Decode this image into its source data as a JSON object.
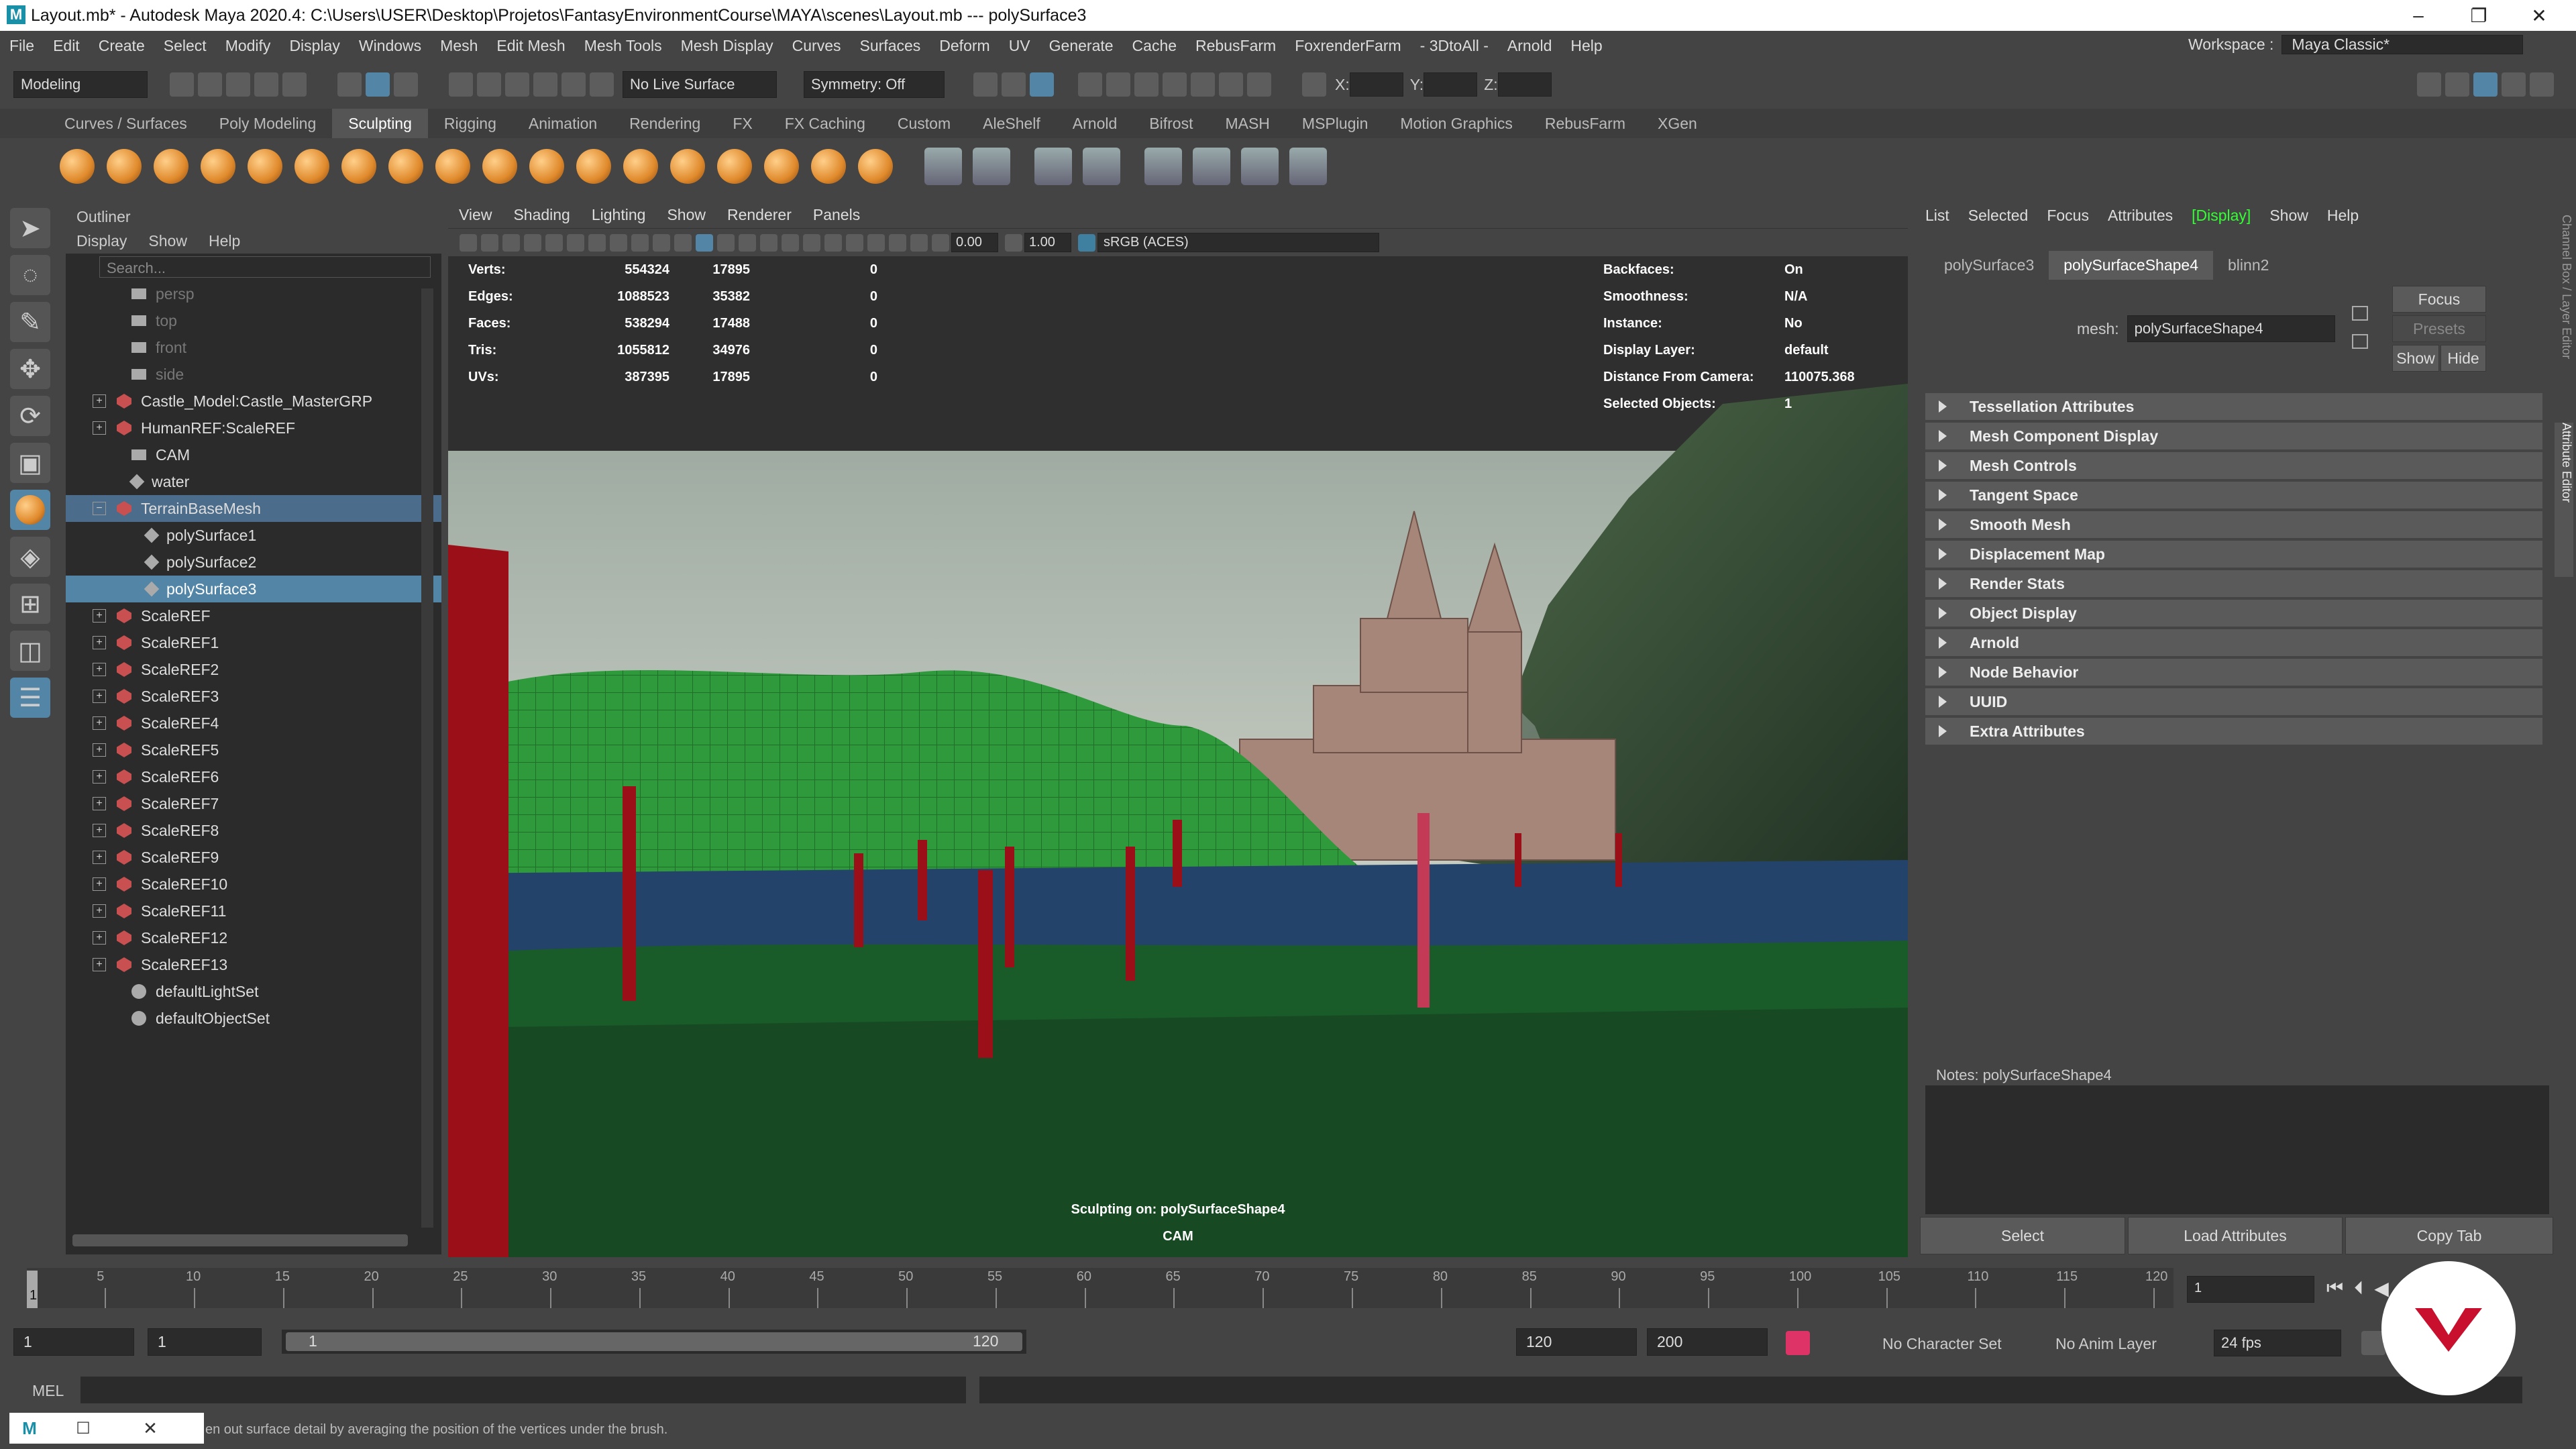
{
  "window": {
    "title": "Layout.mb* - Autodesk Maya 2020.4: C:\\Users\\USER\\Desktop\\Projetos\\FantasyEnvironmentCourse\\MAYA\\scenes\\Layout.mb   ---   polySurface3",
    "min": "–",
    "max": "❐",
    "close": "✕"
  },
  "menubar": [
    "File",
    "Edit",
    "Create",
    "Select",
    "Modify",
    "Display",
    "Windows",
    "Mesh",
    "Edit Mesh",
    "Mesh Tools",
    "Mesh Display",
    "Curves",
    "Surfaces",
    "Deform",
    "UV",
    "Generate",
    "Cache",
    "RebusFarm",
    "FoxrenderFarm",
    "- 3DtoAll -",
    "Arnold",
    "Help"
  ],
  "workspace": {
    "label": "Workspace :",
    "value": "Maya Classic*"
  },
  "statusline": {
    "menuset": "Modeling",
    "live_surface": "No Live Surface",
    "symmetry": "Symmetry: Off",
    "x": "X:",
    "y": "Y:",
    "z": "Z:"
  },
  "shelf_tabs": [
    "Curves / Surfaces",
    "Poly Modeling",
    "Sculpting",
    "Rigging",
    "Animation",
    "Rendering",
    "FX",
    "FX Caching",
    "Custom",
    "AleShelf",
    "Arnold",
    "Bifrost",
    "MASH",
    "MSPlugin",
    "Motion Graphics",
    "RebusFarm",
    "XGen"
  ],
  "shelf_active": "Sculpting",
  "outliner": {
    "title": "Outliner",
    "menu": [
      "Display",
      "Show",
      "Help"
    ],
    "search_placeholder": "Search...",
    "items": [
      {
        "label": "persp",
        "kind": "camera",
        "depth": 1,
        "dim": true
      },
      {
        "label": "top",
        "kind": "camera",
        "depth": 1,
        "dim": true
      },
      {
        "label": "front",
        "kind": "camera",
        "depth": 1,
        "dim": true
      },
      {
        "label": "side",
        "kind": "camera",
        "depth": 1,
        "dim": true
      },
      {
        "label": "Castle_Model:Castle_MasterGRP",
        "kind": "group",
        "depth": 0,
        "expand": "+"
      },
      {
        "label": "HumanREF:ScaleREF",
        "kind": "group",
        "depth": 0,
        "expand": "+"
      },
      {
        "label": "CAM",
        "kind": "camera",
        "depth": 1
      },
      {
        "label": "water",
        "kind": "mesh",
        "depth": 1
      },
      {
        "label": "TerrainBaseMesh",
        "kind": "group",
        "depth": 0,
        "expand": "−",
        "state": "hl"
      },
      {
        "label": "polySurface1",
        "kind": "mesh",
        "depth": 2
      },
      {
        "label": "polySurface2",
        "kind": "mesh",
        "depth": 2
      },
      {
        "label": "polySurface3",
        "kind": "mesh",
        "depth": 2,
        "state": "sel"
      },
      {
        "label": "ScaleREF",
        "kind": "group",
        "depth": 0,
        "expand": "+"
      },
      {
        "label": "ScaleREF1",
        "kind": "group",
        "depth": 0,
        "expand": "+"
      },
      {
        "label": "ScaleREF2",
        "kind": "group",
        "depth": 0,
        "expand": "+"
      },
      {
        "label": "ScaleREF3",
        "kind": "group",
        "depth": 0,
        "expand": "+"
      },
      {
        "label": "ScaleREF4",
        "kind": "group",
        "depth": 0,
        "expand": "+"
      },
      {
        "label": "ScaleREF5",
        "kind": "group",
        "depth": 0,
        "expand": "+"
      },
      {
        "label": "ScaleREF6",
        "kind": "group",
        "depth": 0,
        "expand": "+"
      },
      {
        "label": "ScaleREF7",
        "kind": "group",
        "depth": 0,
        "expand": "+"
      },
      {
        "label": "ScaleREF8",
        "kind": "group",
        "depth": 0,
        "expand": "+"
      },
      {
        "label": "ScaleREF9",
        "kind": "group",
        "depth": 0,
        "expand": "+"
      },
      {
        "label": "ScaleREF10",
        "kind": "group",
        "depth": 0,
        "expand": "+"
      },
      {
        "label": "ScaleREF11",
        "kind": "group",
        "depth": 0,
        "expand": "+"
      },
      {
        "label": "ScaleREF12",
        "kind": "group",
        "depth": 0,
        "expand": "+"
      },
      {
        "label": "ScaleREF13",
        "kind": "group",
        "depth": 0,
        "expand": "+"
      },
      {
        "label": "defaultLightSet",
        "kind": "set",
        "depth": 1
      },
      {
        "label": "defaultObjectSet",
        "kind": "set",
        "depth": 1
      }
    ]
  },
  "viewport": {
    "menu": [
      "View",
      "Shading",
      "Lighting",
      "Show",
      "Renderer",
      "Panels"
    ],
    "exposure": "0.00",
    "gamma": "1.00",
    "colorspace": "sRGB (ACES)",
    "hud_left": [
      {
        "label": "Verts:",
        "a": "554324",
        "b": "17895",
        "c": "0"
      },
      {
        "label": "Edges:",
        "a": "1088523",
        "b": "35382",
        "c": "0"
      },
      {
        "label": "Faces:",
        "a": "538294",
        "b": "17488",
        "c": "0"
      },
      {
        "label": "Tris:",
        "a": "1055812",
        "b": "34976",
        "c": "0"
      },
      {
        "label": "UVs:",
        "a": "387395",
        "b": "17895",
        "c": "0"
      }
    ],
    "hud_right": [
      {
        "label": "Backfaces:",
        "value": "On"
      },
      {
        "label": "Smoothness:",
        "value": "N/A"
      },
      {
        "label": "Instance:",
        "value": "No"
      },
      {
        "label": "Display Layer:",
        "value": "default"
      },
      {
        "label": "Distance From Camera:",
        "value": "110075.368"
      },
      {
        "label": "Selected Objects:",
        "value": "1"
      }
    ],
    "sculpt_msg": "Sculpting on: polySurfaceShape4",
    "camera": "CAM"
  },
  "attr_editor": {
    "menu": [
      "List",
      "Selected",
      "Focus",
      "Attributes",
      "[Display]",
      "Show",
      "Help"
    ],
    "tabs": [
      "polySurface3",
      "polySurfaceShape4",
      "blinn2"
    ],
    "active_tab": "polySurfaceShape4",
    "mesh_label": "mesh:",
    "mesh_value": "polySurfaceShape4",
    "focus": "Focus",
    "presets": "Presets",
    "show": "Show",
    "hide": "Hide",
    "sections": [
      "Tessellation Attributes",
      "Mesh Component Display",
      "Mesh Controls",
      "Tangent Space",
      "Smooth Mesh",
      "Displacement Map",
      "Render Stats",
      "Object Display",
      "Arnold",
      "Node Behavior",
      "UUID",
      "Extra Attributes"
    ],
    "notes_label": "Notes:  polySurfaceShape4",
    "btn_select": "Select",
    "btn_load": "Load Attributes",
    "btn_copy": "Copy Tab",
    "side_tabs": "Channel Box / Layer Editor",
    "side_tab2": "Attribute Editor"
  },
  "timeline": {
    "ticks": [
      "5",
      "10",
      "15",
      "20",
      "25",
      "30",
      "35",
      "40",
      "45",
      "50",
      "55",
      "60",
      "65",
      "70",
      "75",
      "80",
      "85",
      "90",
      "95",
      "100",
      "105",
      "110",
      "115",
      "120"
    ],
    "current": "1",
    "frame_field": "1"
  },
  "range": {
    "start": "1",
    "playback_start": "1",
    "slider_start": "1",
    "slider_end": "120",
    "playback_end": "120",
    "end": "200",
    "char_set": "No Character Set",
    "anim_layer": "No Anim Layer",
    "fps": "24 fps"
  },
  "cmdline": {
    "label": "MEL"
  },
  "helpline": {
    "text": "en out surface detail by averaging the position of the vertices under the brush."
  }
}
